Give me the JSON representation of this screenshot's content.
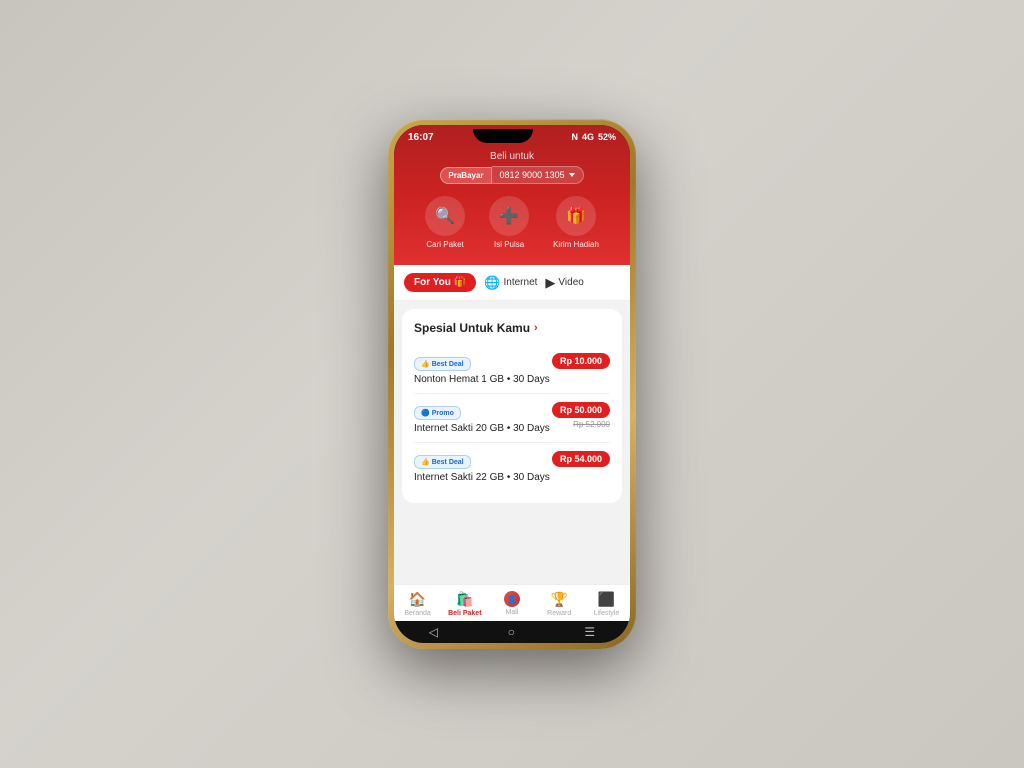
{
  "scene": {
    "background": "#d0ccc8"
  },
  "status_bar": {
    "time": "16:07",
    "network": "N",
    "signal_4g": "4G",
    "battery": "52%"
  },
  "header": {
    "beli_untuk_label": "Beli untuk",
    "phone_badge": "PraBayar",
    "phone_number": "0812 9000 1305"
  },
  "actions": [
    {
      "id": "cari-paket",
      "icon": "🔍",
      "label": "Cari Paket"
    },
    {
      "id": "isi-pulsa",
      "icon": "➕",
      "label": "Isi Pulsa"
    },
    {
      "id": "kirim-hadiah",
      "icon": "🎁",
      "label": "Kirim Hadiah"
    }
  ],
  "tabs": [
    {
      "id": "for-you",
      "label": "For You",
      "icon": "🎁",
      "active": true
    },
    {
      "id": "internet",
      "label": "Internet",
      "icon": "🌐",
      "active": false
    },
    {
      "id": "video",
      "label": "Video",
      "icon": "▶",
      "active": false
    }
  ],
  "special_section": {
    "title": "Spesial Untuk Kamu",
    "arrow": "›",
    "packages": [
      {
        "badge_type": "best-deal",
        "badge_label": "Best Deal",
        "name": "Nonton Hemat 1 GB • 30 Days",
        "price": "Rp 10.000",
        "original_price": null
      },
      {
        "badge_type": "promo",
        "badge_label": "Promo",
        "name": "Internet Sakti 20 GB • 30 Days",
        "price": "Rp 50.000",
        "original_price": "Rp 52.000"
      },
      {
        "badge_type": "best-deal",
        "badge_label": "Best Deal",
        "name": "Internet Sakti 22 GB • 30 Days",
        "price": "Rp 54.000",
        "original_price": null
      }
    ]
  },
  "bottom_nav": [
    {
      "id": "beranda",
      "icon": "🏠",
      "label": "Beranda",
      "active": false
    },
    {
      "id": "beli-paket",
      "icon": "🛍️",
      "label": "Beli Paket",
      "active": true
    },
    {
      "id": "mall",
      "icon": "👤",
      "label": "Mall",
      "active": false
    },
    {
      "id": "reward",
      "icon": "🏆",
      "label": "Reward",
      "active": false
    },
    {
      "id": "lifestyle",
      "icon": "⬛",
      "label": "Lifestyle",
      "active": false
    }
  ],
  "android_nav": {
    "back": "◁",
    "home": "○",
    "recent": "☰"
  }
}
